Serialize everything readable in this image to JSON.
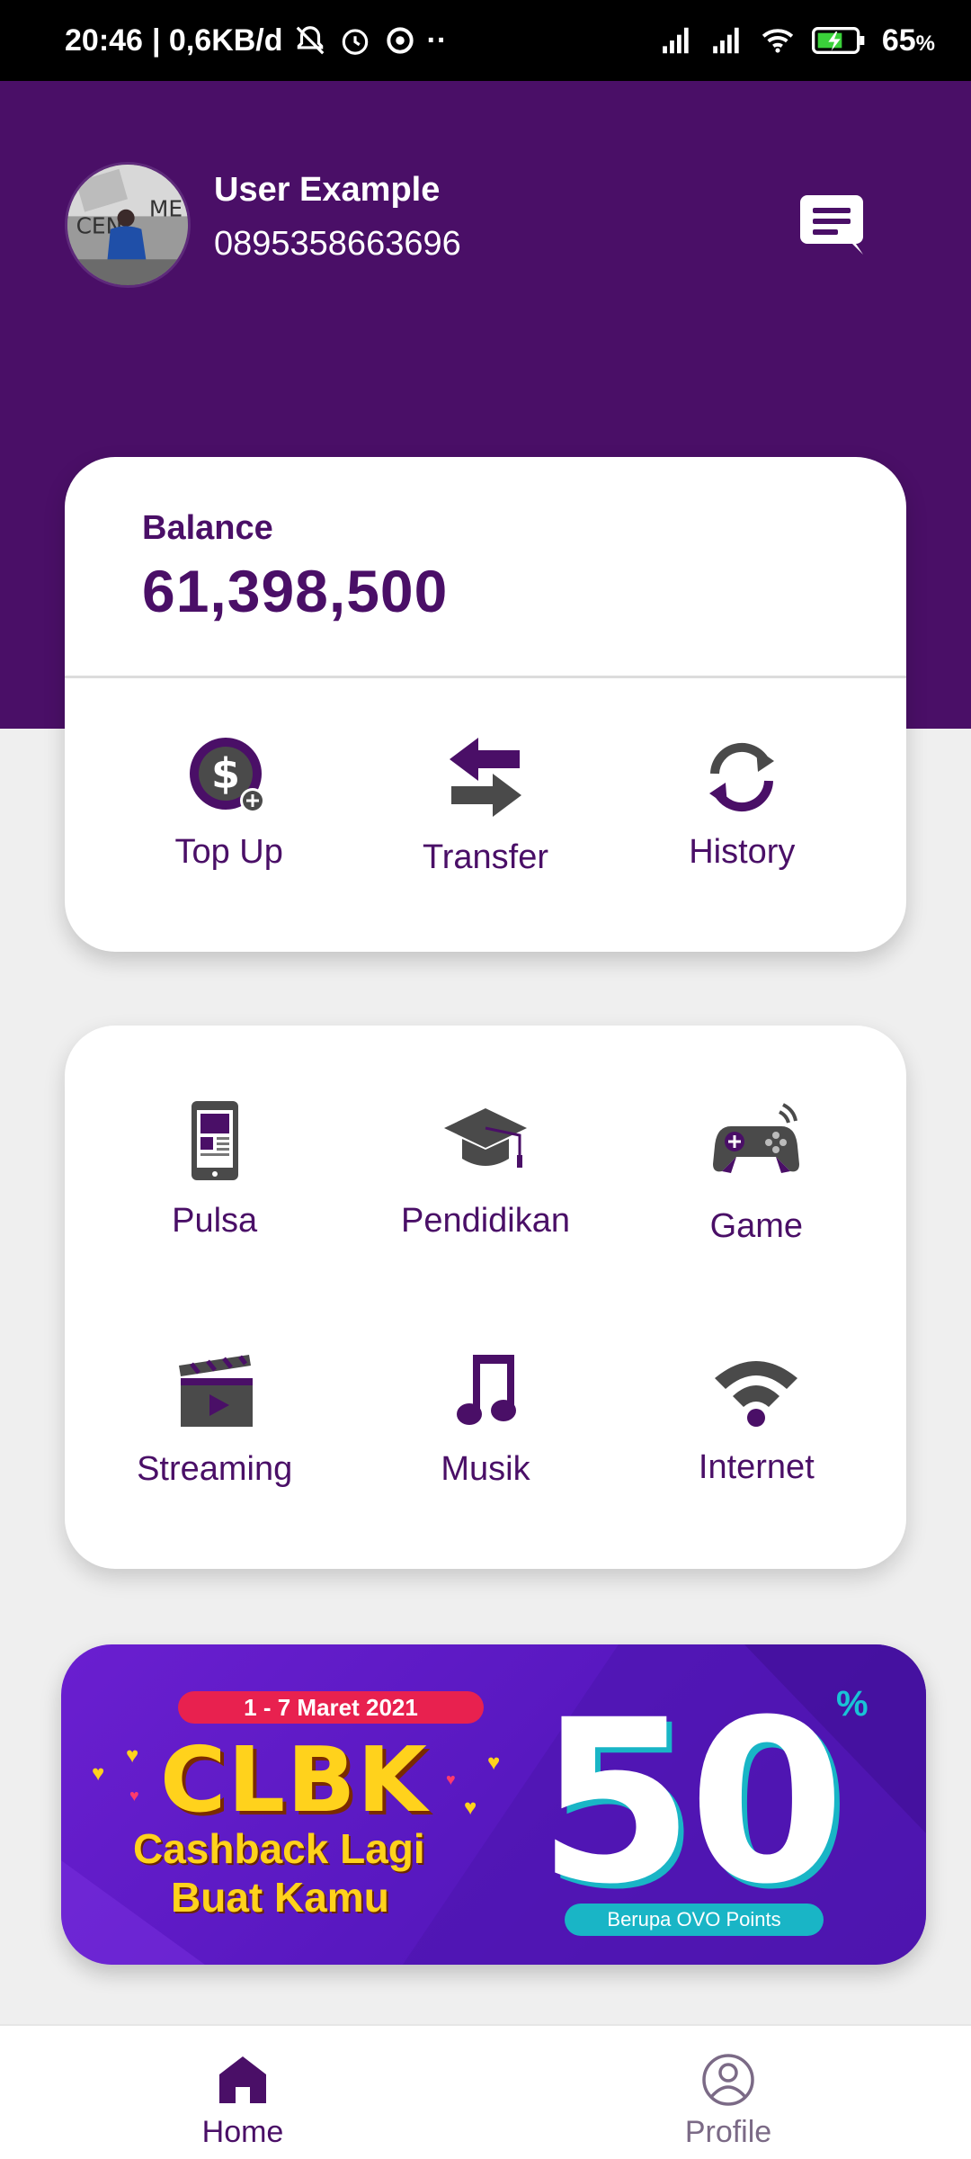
{
  "status_bar": {
    "time": "20:46",
    "speed": "| 0,6KB/d",
    "battery": "65",
    "battery_unit": "%",
    "icons": [
      "muted-bell-icon",
      "alarm-icon",
      "sync-icon",
      "more-dots-icon",
      "signal-icon",
      "signal-icon",
      "wifi-icon",
      "battery-charging-icon"
    ]
  },
  "header": {
    "user_name": "User Example",
    "phone": "0895358663696",
    "message_icon": "message-icon",
    "color": "#4a0f67"
  },
  "balance": {
    "label": "Balance",
    "value": "61,398,500"
  },
  "actions": [
    {
      "label": "Top Up",
      "icon": "top-up-icon"
    },
    {
      "label": "Transfer",
      "icon": "transfer-icon"
    },
    {
      "label": "History",
      "icon": "history-icon"
    }
  ],
  "services": [
    {
      "label": "Pulsa",
      "icon": "phone-icon"
    },
    {
      "label": "Pendidikan",
      "icon": "graduation-cap-icon"
    },
    {
      "label": "Game",
      "icon": "gamepad-icon"
    },
    {
      "label": "Streaming",
      "icon": "clapperboard-icon"
    },
    {
      "label": "Musik",
      "icon": "music-note-icon"
    },
    {
      "label": "Internet",
      "icon": "wifi-icon"
    }
  ],
  "banner": {
    "date": "1 - 7 Maret 2021",
    "title": "CLBK",
    "subtitle_line1": "Cashback Lagi",
    "subtitle_line2": "Buat Kamu",
    "big_number": "50",
    "percent": "%",
    "pill": "Berupa OVO Points"
  },
  "bottom_nav": [
    {
      "label": "Home",
      "icon": "home-icon",
      "active": true
    },
    {
      "label": "Profile",
      "icon": "profile-icon",
      "active": false
    }
  ],
  "colors": {
    "primary": "#4a0f67",
    "icon_gray": "#4a4a4a",
    "background": "#efefef"
  }
}
